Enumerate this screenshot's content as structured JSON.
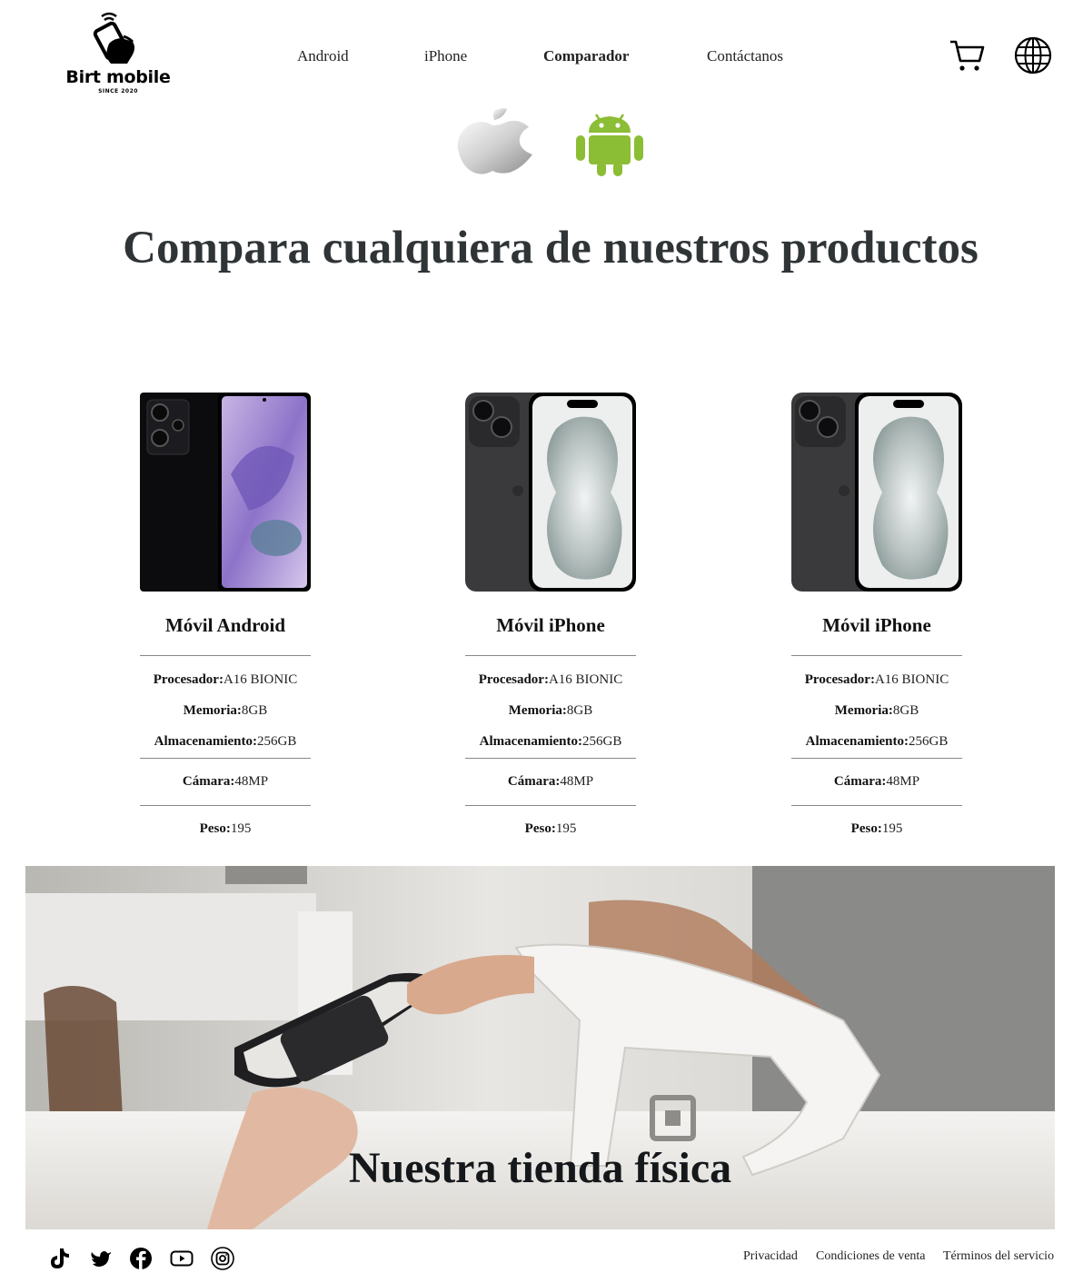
{
  "brand": {
    "name": "Birt mobile",
    "since": "SINCE 2020"
  },
  "nav": {
    "items": [
      {
        "label": "Android",
        "active": false
      },
      {
        "label": "iPhone",
        "active": false
      },
      {
        "label": "Comparador",
        "active": true
      },
      {
        "label": "Contáctanos",
        "active": false
      }
    ]
  },
  "header_icons": [
    "cart-icon",
    "globe-icon"
  ],
  "os_logos": [
    "apple-logo",
    "android-logo"
  ],
  "main": {
    "headline": "Compara cualquiera de nuestros productos"
  },
  "products": [
    {
      "title": "Móvil Android",
      "image": "android-phone",
      "specs": [
        {
          "label": "Procesador:",
          "value": "A16 BIONIC"
        },
        {
          "label": "Memoria:",
          "value": "8GB"
        },
        {
          "label": "Almacenamiento:",
          "value": "256GB"
        },
        {
          "label": "Cámara:",
          "value": "48MP"
        },
        {
          "label": "Peso:",
          "value": "195"
        }
      ]
    },
    {
      "title": "Móvil iPhone",
      "image": "iphone",
      "specs": [
        {
          "label": "Procesador:",
          "value": "A16 BIONIC"
        },
        {
          "label": "Memoria:",
          "value": "8GB"
        },
        {
          "label": "Almacenamiento:",
          "value": "256GB"
        },
        {
          "label": "Cámara:",
          "value": "48MP"
        },
        {
          "label": "Peso:",
          "value": "195"
        }
      ]
    },
    {
      "title": "Móvil iPhone",
      "image": "iphone",
      "specs": [
        {
          "label": "Procesador:",
          "value": "A16 BIONIC"
        },
        {
          "label": "Memoria:",
          "value": "8GB"
        },
        {
          "label": "Almacenamiento:",
          "value": "256GB"
        },
        {
          "label": "Cámara:",
          "value": "48MP"
        },
        {
          "label": "Peso:",
          "value": "195"
        }
      ]
    }
  ],
  "banner": {
    "title": "Nuestra tienda física"
  },
  "footer": {
    "social": [
      "tiktok-icon",
      "twitter-icon",
      "facebook-icon",
      "youtube-icon",
      "instagram-icon"
    ],
    "links": [
      "Privacidad",
      "Condiciones de venta",
      "Términos del servicio"
    ]
  }
}
